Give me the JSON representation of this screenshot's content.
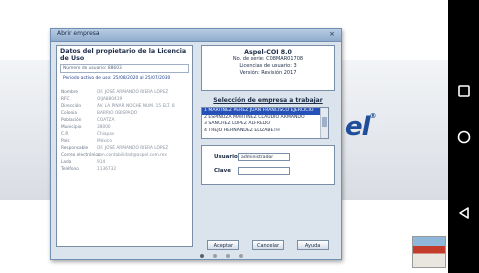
{
  "colors": {
    "dialog_bg": "#dbe3ec",
    "selection": "#2450b8",
    "brand": "#1f4f9a",
    "navbar": "#000000"
  },
  "background": {
    "brand_text": "el",
    "brand_mark": "®"
  },
  "dialog": {
    "title": "Abrir empresa",
    "close_label": "×",
    "left": {
      "title": "Datos del propietario de la Licencia de Uso",
      "line1": "Número de usuario: 88603",
      "line2": "Periodo activo de uso: 25/08/2020 al 25/07/2030",
      "fields": [
        {
          "key": "Nombre",
          "value": "OF. JOSÉ ARMANDO RIERA LÓPEZ"
        },
        {
          "key": "RFC",
          "value": "OIJA880419"
        },
        {
          "key": "Dirección",
          "value": "AV. LA PINAR NOCHE NUM. 15 ELT. 8"
        },
        {
          "key": "Colonia",
          "value": "BARRIO OBISPADO"
        },
        {
          "key": "Población",
          "value": "COATZA"
        },
        {
          "key": "Municipio",
          "value": "38000"
        },
        {
          "key": "C.P.",
          "value": "Chiapas"
        },
        {
          "key": "País",
          "value": "México"
        },
        {
          "key": "Responsable",
          "value": "OF. JOSÉ ARMANDO RIERA LÓPEZ"
        },
        {
          "key": "Correo electrónico",
          "value": "con.contabilidad@aspel.com.mx"
        },
        {
          "key": "Lada",
          "value": "914"
        },
        {
          "key": "Teléfono",
          "value": "1136732"
        }
      ]
    },
    "right": {
      "app_name": "Aspel-COI 8.0",
      "serie": "No. de serie: C08MAR01708",
      "licencias": "Licencias de usuario: 3",
      "version": "Versión: Revisión 2017",
      "select_label": "Selección de empresa a trabajar",
      "companies": [
        "1 MARTÍNEZ PEREZ JUAN FRANCISCO EJERCICIO",
        "2 ESPINOZA MARTÍNEZ CLAUDIO ARMANDO",
        "3 SANCHEZ LÓPEZ ALFREDO",
        "4 TREJO HERNÁNDEZ ELIZABETH"
      ],
      "user_label": "Usuario",
      "user_value": "administrador",
      "key_label": "Clave",
      "key_value": "",
      "buttons": {
        "accept": "Aceptar",
        "cancel": "Cancelar",
        "help": "Ayuda"
      }
    }
  },
  "pager": {
    "count": 4,
    "active_index": 0
  },
  "navbar": {
    "icons": [
      "recents-square-icon",
      "home-circle-icon",
      "back-triangle-icon"
    ]
  }
}
